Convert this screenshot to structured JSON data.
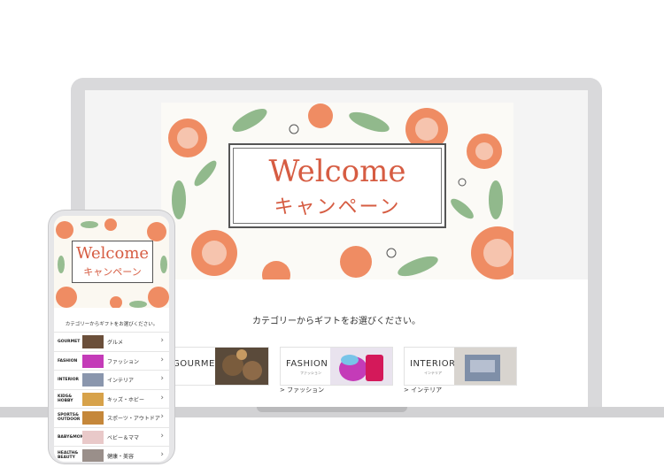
{
  "desktop": {
    "hero": {
      "title_en": "Welcome",
      "title_jp": "キャンペーン"
    },
    "prompt": "カテゴリーからギフトをお選びください。",
    "categories": [
      {
        "title": "GOURMET",
        "link": "メ"
      },
      {
        "title": "FASHION",
        "sub": "ファッション",
        "link": "> ファッション"
      },
      {
        "title": "INTERIOR",
        "sub": "インテリア",
        "link": "> インテリア"
      }
    ]
  },
  "phone": {
    "hero": {
      "title_en": "Welcome",
      "title_jp": "キャンペーン"
    },
    "prompt": "カテゴリーからギフトをお選びください。",
    "items": [
      {
        "label": "GOURMET",
        "jp": "グルメ"
      },
      {
        "label": "FASHION",
        "jp": "ファッション"
      },
      {
        "label": "INTERIOR",
        "jp": "インテリア"
      },
      {
        "label": "KIDS&\nHOBBY",
        "jp": "キッズ・ホビー"
      },
      {
        "label": "SPORTS&\nOUTDOOR",
        "jp": "スポーツ・アウトドア"
      },
      {
        "label": "BABY&MOM",
        "jp": "ベビー＆ママ"
      },
      {
        "label": "HEALTH&\nBEAUTY",
        "jp": "健康・美容"
      }
    ],
    "arrow": "›"
  },
  "colors": {
    "accent": "#d65c42",
    "leaf": "#7fae7a",
    "flower": "#ef8c63"
  }
}
